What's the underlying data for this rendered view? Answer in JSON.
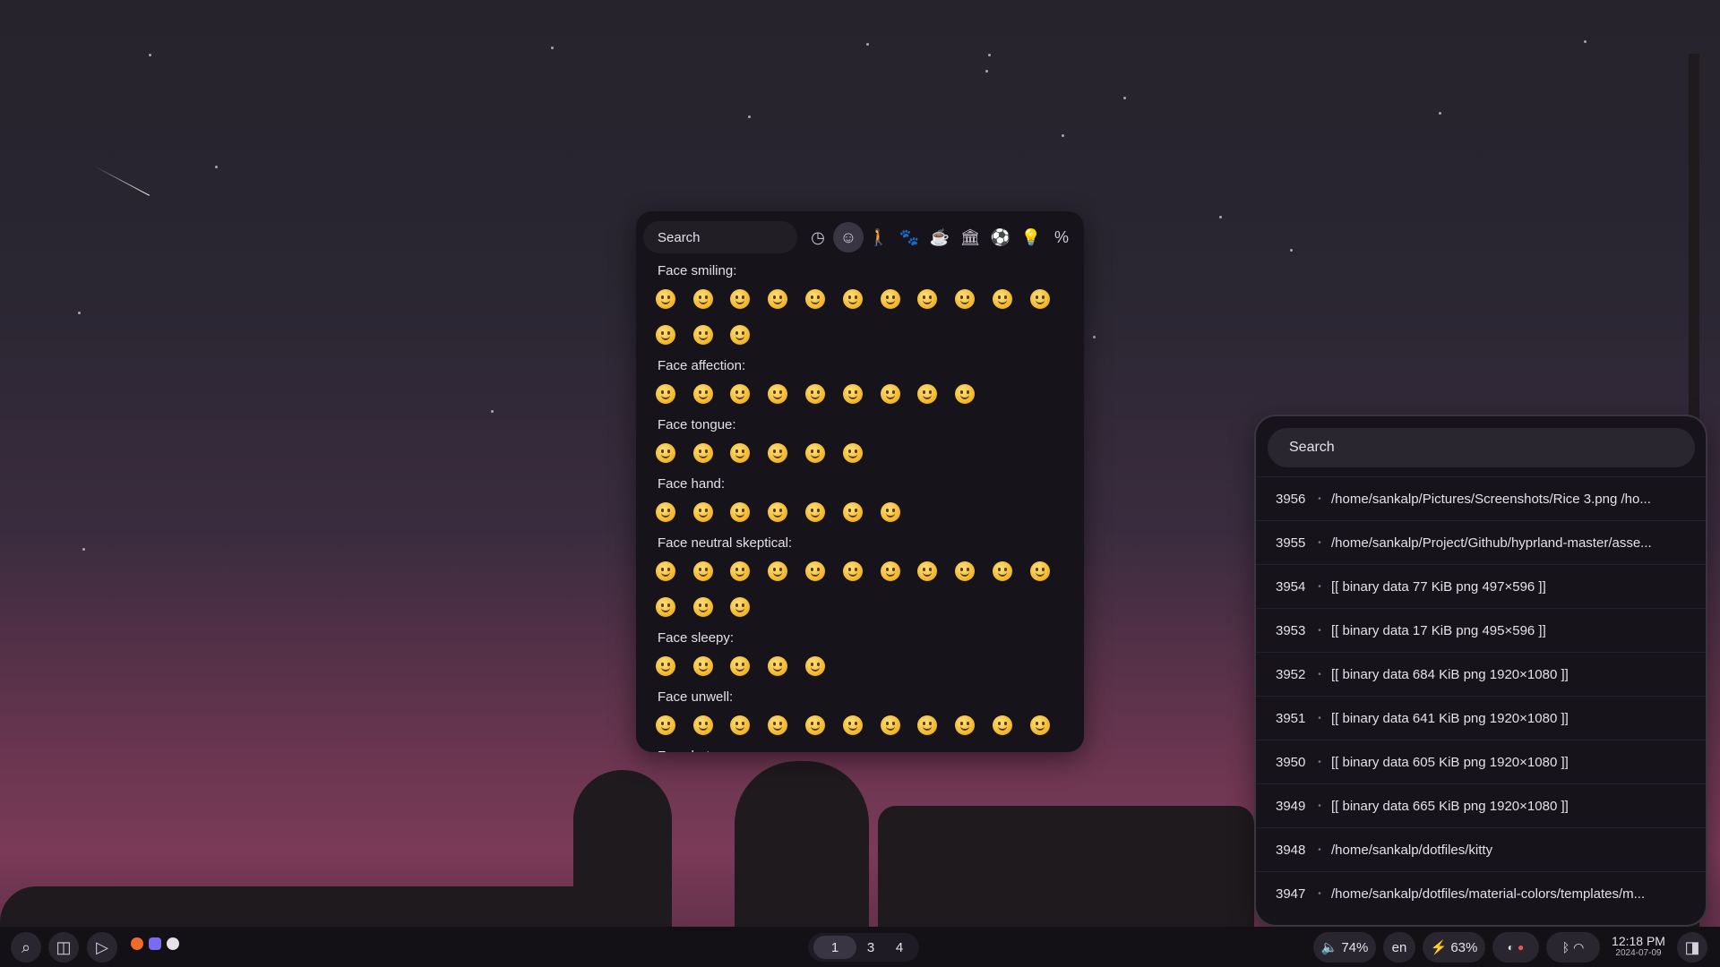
{
  "emoji_picker": {
    "search_placeholder": "Search",
    "categories": [
      {
        "icon": "clock-icon",
        "glyph": "◷",
        "active": false
      },
      {
        "icon": "smiley-icon",
        "glyph": "☺",
        "active": true
      },
      {
        "icon": "person-icon",
        "glyph": "🚶",
        "active": false
      },
      {
        "icon": "paw-icon",
        "glyph": "🐾",
        "active": false
      },
      {
        "icon": "food-icon",
        "glyph": "☕",
        "active": false
      },
      {
        "icon": "building-icon",
        "glyph": "🏛",
        "active": false
      },
      {
        "icon": "ball-icon",
        "glyph": "⚽",
        "active": false
      },
      {
        "icon": "bulb-icon",
        "glyph": "💡",
        "active": false
      },
      {
        "icon": "symbols-icon",
        "glyph": "%",
        "active": false
      }
    ],
    "groups": [
      {
        "title": "Face smiling:",
        "count": 14
      },
      {
        "title": "Face affection:",
        "count": 9
      },
      {
        "title": "Face tongue:",
        "count": 6
      },
      {
        "title": "Face hand:",
        "count": 7
      },
      {
        "title": "Face neutral skeptical:",
        "count": 14
      },
      {
        "title": "Face sleepy:",
        "count": 5
      },
      {
        "title": "Face unwell:",
        "count": 11
      },
      {
        "title": "Face hat:",
        "count": 0
      }
    ]
  },
  "clipboard": {
    "search_placeholder": "Search",
    "items": [
      {
        "id": "3956",
        "text": "/home/sankalp/Pictures/Screenshots/Rice 3.png /ho..."
      },
      {
        "id": "3955",
        "text": "/home/sankalp/Project/Github/hyprland-master/asse..."
      },
      {
        "id": "3954",
        "text": "[[ binary data 77 KiB png 497×596 ]]"
      },
      {
        "id": "3953",
        "text": "[[ binary data 17 KiB png 495×596 ]]"
      },
      {
        "id": "3952",
        "text": "[[ binary data 684 KiB png 1920×1080 ]]"
      },
      {
        "id": "3951",
        "text": "[[ binary data 641 KiB png 1920×1080 ]]"
      },
      {
        "id": "3950",
        "text": "[[ binary data 605 KiB png 1920×1080 ]]"
      },
      {
        "id": "3949",
        "text": "[[ binary data 665 KiB png 1920×1080 ]]"
      },
      {
        "id": "3948",
        "text": "/home/sankalp/dotfiles/kitty"
      },
      {
        "id": "3947",
        "text": "/home/sankalp/dotfiles/material-colors/templates/m..."
      }
    ]
  },
  "bar": {
    "workspaces": [
      {
        "label": "1",
        "active": true
      },
      {
        "label": "3",
        "active": false
      },
      {
        "label": "4",
        "active": false
      }
    ],
    "volume": "74%",
    "language": "en",
    "battery": "63%",
    "time": "12:18 PM",
    "date": "2024-07-09"
  }
}
